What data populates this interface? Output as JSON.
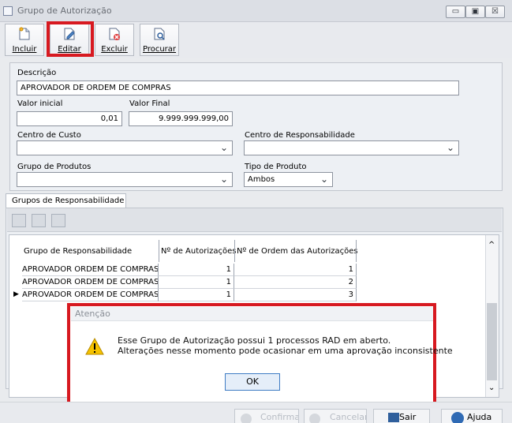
{
  "window": {
    "title": "Grupo de Autorização",
    "buttons": [
      "▭",
      "▣",
      "☒"
    ]
  },
  "toolbar": {
    "items": [
      {
        "label": "Incluir"
      },
      {
        "label": "Editar"
      },
      {
        "label": "Excluir"
      },
      {
        "label": "Procurar"
      }
    ]
  },
  "form": {
    "descricao_label": "Descrição",
    "descricao_value": "APROVADOR DE ORDEM DE COMPRAS",
    "valor_inicial_label": "Valor inicial",
    "valor_inicial_value": "0,01",
    "valor_final_label": "Valor Final",
    "valor_final_value": "9.999.999.999,00",
    "centro_custo_label": "Centro de Custo",
    "centro_custo_value": "",
    "centro_resp_label": "Centro de Responsabilidade",
    "centro_resp_value": "",
    "grupo_produtos_label": "Grupo de Produtos",
    "grupo_produtos_value": "",
    "tipo_produto_label": "Tipo de Produto",
    "tipo_produto_value": "Ambos"
  },
  "tabs": {
    "active": "Grupos de Responsabilidade"
  },
  "grid": {
    "columns": [
      "Grupo de Responsabilidade",
      "Nº de Autorizações",
      "Nº de Ordem das Autorizações"
    ],
    "rows": [
      {
        "grupo": "APROVADOR ORDEM DE COMPRAS",
        "autorizacoes": "1",
        "ordem": "1"
      },
      {
        "grupo": "APROVADOR ORDEM DE COMPRAS",
        "autorizacoes": "1",
        "ordem": "2"
      },
      {
        "grupo": "APROVADOR ORDEM DE COMPRAS",
        "autorizacoes": "1",
        "ordem": "3"
      }
    ],
    "current_row_marker": "▶"
  },
  "dialog": {
    "title": "Atenção",
    "message_line1": "Esse Grupo de Autorização possui 1 processos RAD em aberto.",
    "message_line2": "Alterações nesse momento pode ocasionar em uma aprovação inconsistente",
    "ok_label": "OK"
  },
  "footer": {
    "confirmar_label": "Confirmar",
    "cancelar_label": "Cancelar",
    "sair_label": "Sair",
    "ajuda_label": "Ajuda"
  },
  "colors": {
    "highlight": "#d71920",
    "accent": "#3f7cc4"
  }
}
